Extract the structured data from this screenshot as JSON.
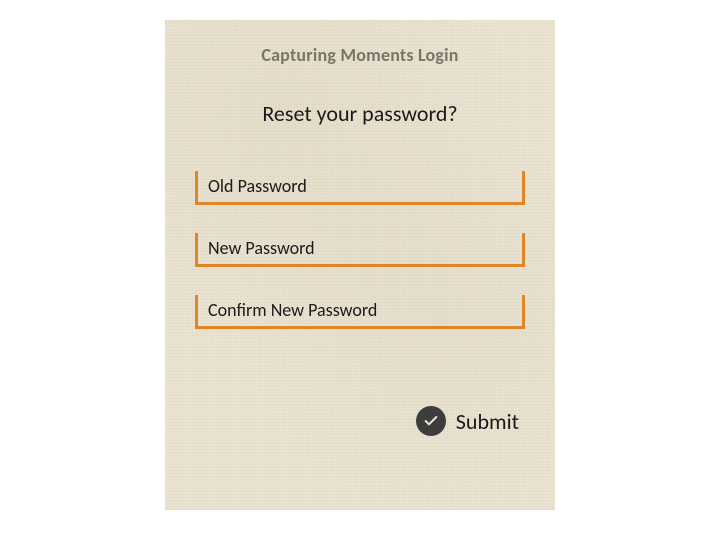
{
  "header": {
    "title": "Capturing Moments Login",
    "subtitle": "Reset your password?"
  },
  "fields": {
    "old_password": {
      "placeholder": "Old Password"
    },
    "new_password": {
      "placeholder": "New Password"
    },
    "confirm_password": {
      "placeholder": "Confirm New Password"
    }
  },
  "actions": {
    "submit_label": "Submit"
  }
}
